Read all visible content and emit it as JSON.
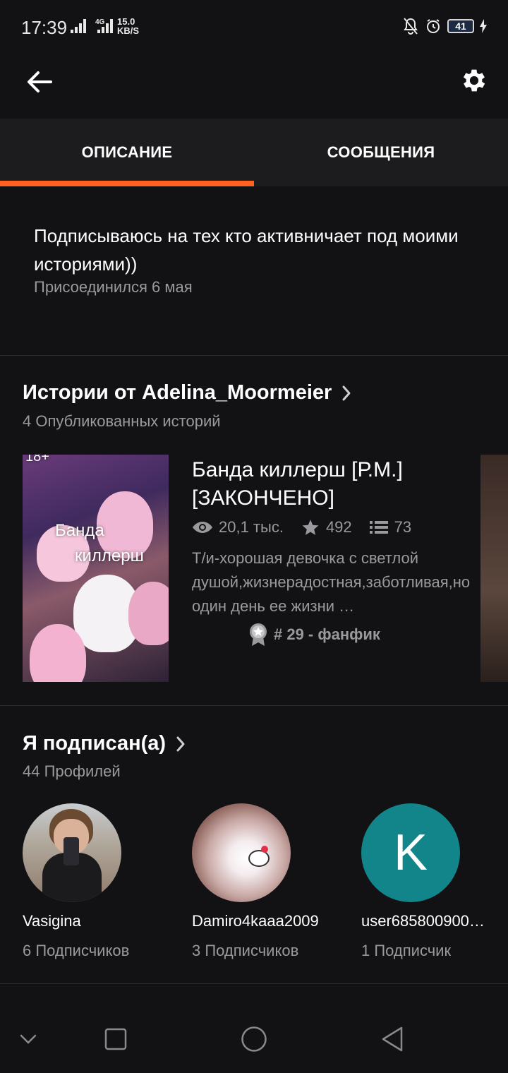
{
  "status_bar": {
    "time": "17:39",
    "network_type": "4G",
    "speed_value": "15.0",
    "speed_unit": "KB/S",
    "battery": "41",
    "icons": [
      "signal-icon",
      "signal-4g-icon",
      "bell-muted-icon",
      "alarm-icon",
      "battery-icon",
      "charging-icon"
    ]
  },
  "top_bar": {
    "back_icon": "arrow-left-icon",
    "settings_icon": "gear-icon"
  },
  "tabs": [
    {
      "label": "ОПИСАНИЕ",
      "active": true
    },
    {
      "label": "СООБЩЕНИЯ",
      "active": false
    }
  ],
  "accent_color": "#ff6122",
  "description": {
    "text": "Подписываюсь на тех кто активничает под моими историями))",
    "joined": "Присоединился 6 мая"
  },
  "stories": {
    "title": "Истории от Adelina_Moormeier",
    "subtitle": "4 Опубликованных историй",
    "items": [
      {
        "cover_badge": "18+",
        "cover_line1": "Банда",
        "cover_line2": "киллерш",
        "title": "Банда киллерш [Р.М.] [ЗАКОНЧЕНО]",
        "reads": "20,1 тыс.",
        "votes": "492",
        "parts": "73",
        "description": "Т/и-хорошая девочка с светлой душой,жизнерадостная,заботливая,но один день ее жизни …",
        "rank": "# 29 - фанфик"
      }
    ]
  },
  "following": {
    "title": "Я подписан(а)",
    "subtitle": "44 Профилей",
    "profiles": [
      {
        "name": "Vasigina",
        "followers": "6 Подписчиков",
        "avatar": "photo"
      },
      {
        "name": "Damiro4kaaa2009",
        "followers": "3 Подписчиков",
        "avatar": "photo"
      },
      {
        "name": "user685800900…",
        "followers": "1 Подписчик",
        "avatar_letter": "K",
        "avatar_color": "#12858a"
      }
    ]
  },
  "nav_bar": {
    "icons": [
      "chevron-down-icon",
      "square-icon",
      "circle-icon",
      "triangle-back-icon"
    ]
  }
}
